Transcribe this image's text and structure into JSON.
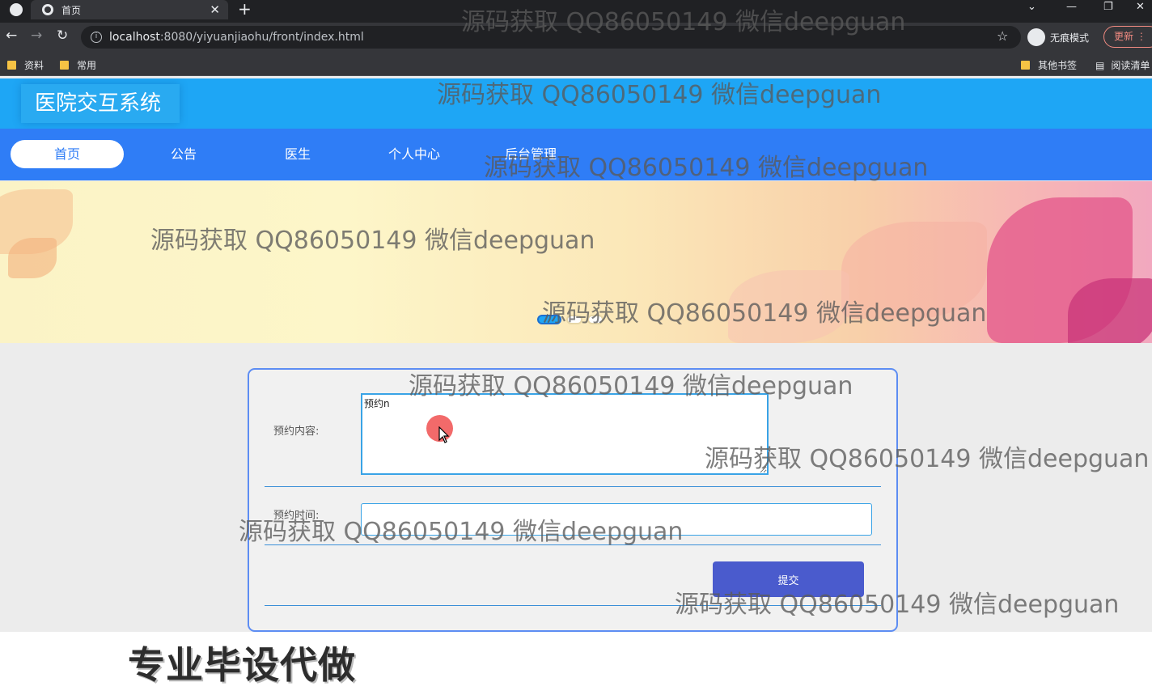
{
  "browser": {
    "tab_title": "首页",
    "url_host": "localhost",
    "url_rest": ":8080/yiyuanjiaohu/front/index.html",
    "incognito_label": "无痕模式",
    "update_label": "更新",
    "bookmarks": [
      "资料",
      "常用"
    ],
    "bookmarks_right": [
      "其他书签",
      "阅读清单"
    ]
  },
  "site": {
    "title": "医院交互系统",
    "nav": [
      "首页",
      "公告",
      "医生",
      "个人中心",
      "后台管理"
    ],
    "active_nav": "首页"
  },
  "form": {
    "content_label": "预约内容:",
    "content_value": "预约n",
    "time_label": "预约时间:",
    "time_value": "",
    "submit_label": "提交"
  },
  "banner": {
    "slides": 3,
    "active_slide": 1
  },
  "overlay": {
    "watermark": "源码获取 QQ86050149 微信deepguan",
    "promo": "专业毕设代做"
  },
  "colors": {
    "header": "#1ea6f5",
    "navbar": "#2f7df6",
    "submit": "#4a5bcd",
    "card_border": "#5d8df3"
  }
}
